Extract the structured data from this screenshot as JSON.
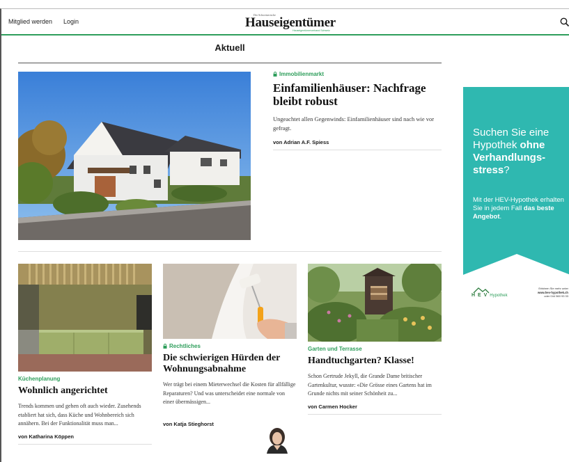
{
  "header": {
    "member_link": "Mitglied werden",
    "login_link": "Login",
    "logo_kicker": "Der Schweizerische",
    "logo_name": "Hauseigentümer",
    "logo_tagline": "Hauseigentümerverband Schweiz",
    "search_icon": "search-icon"
  },
  "section": {
    "title": "Aktuell"
  },
  "hero": {
    "category": "Immobilienmarkt",
    "title": "Einfamilienhäuser: Nachfrage bleibt robust",
    "lead": "Ungeachtet allen Gegenwinds: Einfamilienhäuser sind nach wie vor gefragt.",
    "author": "von Adrian A.F. Spiess"
  },
  "cards": [
    {
      "category": "Küchenplanung",
      "title": "Wohnlich angerichtet",
      "body": "Trends kommen und gehen oft auch wieder. Zusehends etabliert hat sich, dass Küche und Wohnbereich sich annähern. Bei der Funktionalität muss man...",
      "author": "von Katharina Köppen"
    },
    {
      "category": "Rechtliches",
      "title": "Die schwierigen Hürden der Wohnungsabnahme",
      "body": "Wer trägt bei einem Mieterwechsel die Kosten für allfällige Reparaturen? Und was unterscheidet eine normale von einer übermässigen...",
      "author": "von Katja Stieghorst"
    },
    {
      "category": "Garten und Terrasse",
      "title": "Handtuchgarten? Klasse!",
      "body": "Schon Gertrude Jekyll, die Grande Dame britischer Gartenkultur, wusste: «Die Grösse eines Gartens hat im Grunde nichts mit seiner Schönheit zu...",
      "author": "von Carmen Hocker"
    }
  ],
  "ad": {
    "headline_1": "Suchen Sie eine Hypothek ",
    "headline_bold": "ohne Verhandlungs-stress",
    "headline_2": "?",
    "sub_1": "Mit der HEV-Hypothek erhalten Sie in jedem Fall ",
    "sub_bold": "das beste Angebot",
    "sub_2": ".",
    "brand": "H E V",
    "brand_sub": "Hypothek",
    "contact_1": "Erfahren Sie mehr unter",
    "contact_2": "www.hev-hypothek.ch",
    "contact_3": "oder 044 560 93 33"
  },
  "colors": {
    "accent": "#2e9e5b",
    "ad_bg": "#2fb8b0"
  }
}
